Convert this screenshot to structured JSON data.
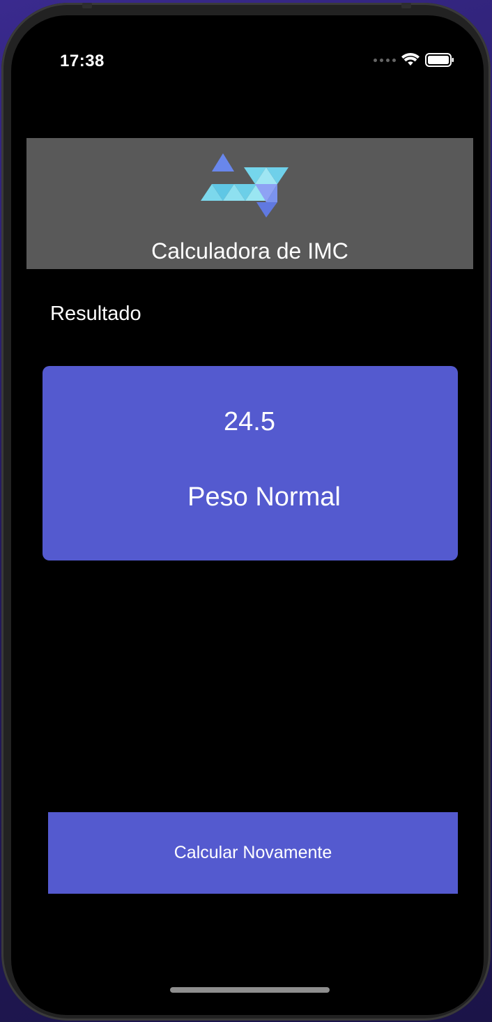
{
  "status_bar": {
    "time": "17:38",
    "icons": [
      "signal-dots-icon",
      "wifi-icon",
      "battery-icon"
    ]
  },
  "header": {
    "logo": "app-logo-triangles",
    "title": "Calculadora de IMC"
  },
  "result_section": {
    "label": "Resultado",
    "bmi_value": "24.5",
    "category": "Peso Normal"
  },
  "actions": {
    "recalculate_label": "Calcular Novamente"
  },
  "colors": {
    "accent": "#545acf",
    "header_bg": "#595959",
    "screen_bg": "#000000",
    "text": "#ffffff"
  }
}
